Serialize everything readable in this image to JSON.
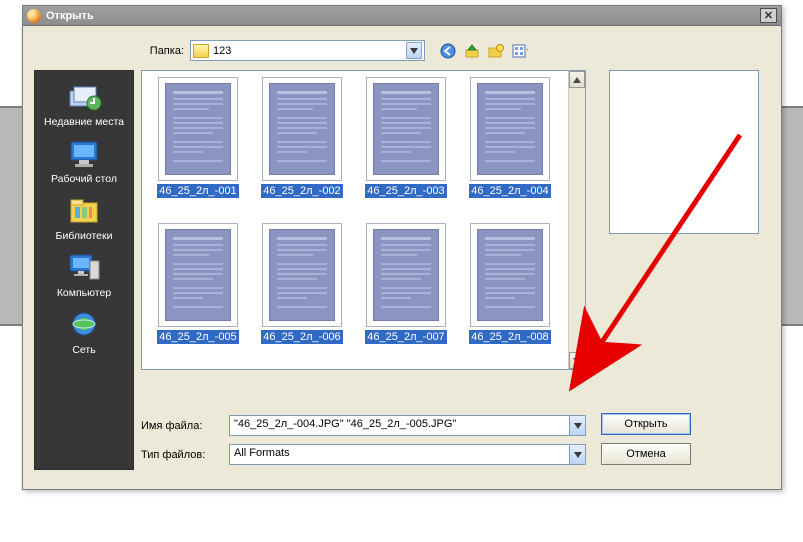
{
  "window": {
    "title": "Открыть"
  },
  "toolbar": {
    "folder_label": "Папка:",
    "folder_name": "123",
    "icons": {
      "back": "back-icon",
      "up": "up-icon",
      "newfolder": "newfolder-icon",
      "views": "views-icon"
    }
  },
  "places": [
    {
      "label": "Недавние места",
      "icon": "recent"
    },
    {
      "label": "Рабочий стол",
      "icon": "desktop"
    },
    {
      "label": "Библиотеки",
      "icon": "library"
    },
    {
      "label": "Компьютер",
      "icon": "computer"
    },
    {
      "label": "Сеть",
      "icon": "network"
    }
  ],
  "files": [
    {
      "name": "46_25_2л_-001",
      "selected": true
    },
    {
      "name": "46_25_2л_-002",
      "selected": true
    },
    {
      "name": "46_25_2л_-003",
      "selected": true
    },
    {
      "name": "46_25_2л_-004",
      "selected": true
    },
    {
      "name": "46_25_2л_-005",
      "selected": true
    },
    {
      "name": "46_25_2л_-006",
      "selected": true
    },
    {
      "name": "46_25_2л_-007",
      "selected": true
    },
    {
      "name": "46_25_2л_-008",
      "selected": true
    }
  ],
  "form": {
    "filename_label": "Имя файла:",
    "filename_value": "\"46_25_2л_-004.JPG\" \"46_25_2л_-005.JPG\"",
    "filetype_label": "Тип файлов:",
    "filetype_value": "All Formats"
  },
  "buttons": {
    "open": "Открыть",
    "cancel": "Отмена"
  }
}
